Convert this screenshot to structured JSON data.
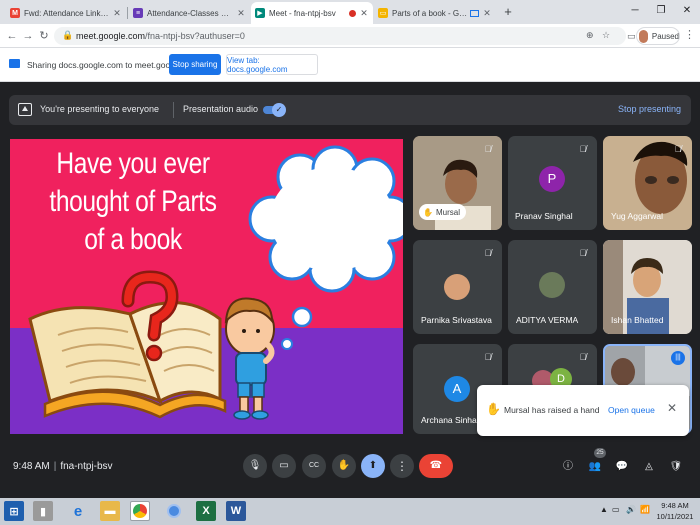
{
  "browser": {
    "tabs": [
      {
        "label": "Fwd: Attendance Link for III - IV",
        "favicon": "gmail-icon",
        "color": "#ea4335",
        "glyph": "M"
      },
      {
        "label": "Attendance-Classes V TO VIII",
        "favicon": "google-forms-icon",
        "color": "#673ab7",
        "glyph": "≡"
      },
      {
        "label": "Meet - fna-ntpj-bsv",
        "favicon": "google-meet-icon",
        "color": "#00897b",
        "glyph": "▶"
      },
      {
        "label": "Parts of a book - Google Sli",
        "favicon": "google-slides-icon",
        "color": "#f4b400",
        "glyph": "▭"
      }
    ],
    "url_host": "meet.google.com",
    "url_path": "/fna-ntpj-bsv?authuser=0",
    "profile_label": "Paused"
  },
  "share_bar": {
    "text": "Sharing docs.google.com to meet.google.com",
    "stop_label": "Stop sharing",
    "view_label": "View tab: docs.google.com"
  },
  "presenting": {
    "text": "You're presenting to everyone",
    "audio_label": "Presentation audio",
    "audio_on": true,
    "stop_label": "Stop presenting"
  },
  "slide": {
    "title_lines": [
      "Have you ever",
      "thought of Parts",
      "of a book"
    ]
  },
  "participants": [
    {
      "name": "Mursal",
      "hand_raised": true,
      "muted": true
    },
    {
      "name": "Pranav Singhal",
      "avatar_letter": "P",
      "avatar_color": "#8e24aa",
      "muted": true
    },
    {
      "name": "Yug Aggarwal",
      "muted": true
    },
    {
      "name": "Parnika Srivastava",
      "muted": true
    },
    {
      "name": "ADITYA VERMA",
      "muted": true
    },
    {
      "name": "Ishan Bhatted",
      "muted": false
    },
    {
      "name": "Archana Sinha",
      "avatar_letter": "A",
      "avatar_color": "#1e88e5",
      "muted": true
    },
    {
      "name": "",
      "avatar_letter": "D",
      "avatar_color": "#7cb342",
      "muted": true
    },
    {
      "name": "",
      "muted": false,
      "speaking": true
    }
  ],
  "notification": {
    "text": "Mursal has raised a hand",
    "action_label": "Open queue"
  },
  "bottom": {
    "time": "9:48 AM",
    "meeting_code": "fna-ntpj-bsv",
    "participant_count": "25"
  },
  "taskbar": {
    "time": "9:48 AM",
    "date": "10/11/2021"
  },
  "colors": {
    "accent": "#1a73e8",
    "present_button": "#8ab4f8",
    "hangup": "#ea4335",
    "slide_pink": "#f0215e",
    "slide_purple": "#7b2fc6"
  }
}
